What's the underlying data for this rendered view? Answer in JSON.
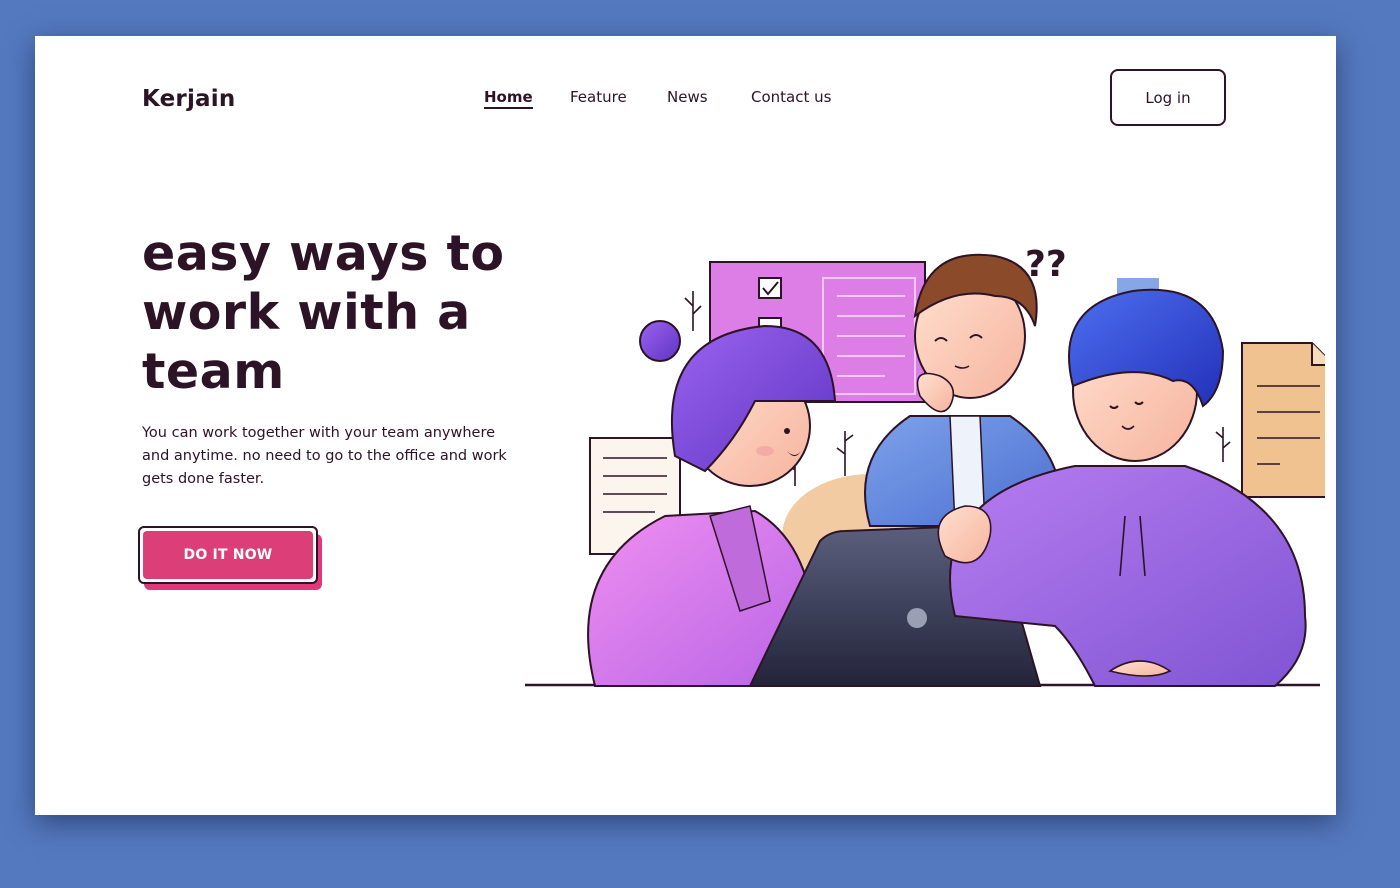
{
  "brand": {
    "logo_text": "Kerjain"
  },
  "nav": {
    "items": [
      {
        "label": "Home",
        "active": true
      },
      {
        "label": "Feature",
        "active": false
      },
      {
        "label": "News",
        "active": false
      },
      {
        "label": "Contact us",
        "active": false
      }
    ],
    "login_label": "Log in"
  },
  "hero": {
    "title_line1": "easy ways to",
    "title_line2": "work with a",
    "title_line3": "team",
    "description": "You can work together with your team anywhere and anytime. no need to go to the office and work gets done faster.",
    "cta_label": "DO IT NOW"
  },
  "colors": {
    "page_background": "#5479bf",
    "text_dark": "#2d1326",
    "cta_pink": "#dc3f77",
    "illustration_purple": "#8a5fd6",
    "illustration_magenta": "#e07ee6"
  },
  "illustration": {
    "name": "team-meeting-illustration"
  }
}
